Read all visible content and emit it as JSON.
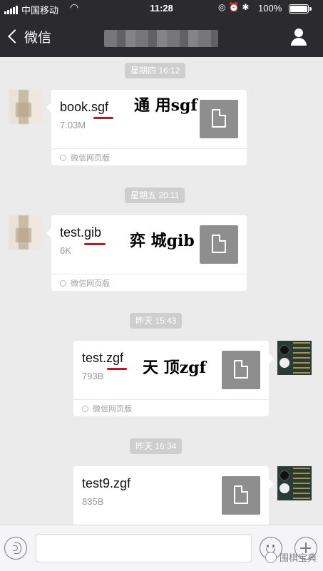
{
  "status_bar": {
    "carrier": "中国移动",
    "time": "11:28",
    "battery": "100%"
  },
  "nav": {
    "back_label": "微信"
  },
  "messages": [
    {
      "time": "星期四 16:12",
      "file_name": "book.sgf",
      "file_size": "7.03M",
      "source": "微信网页版",
      "annotation": "通 用sgf"
    },
    {
      "time": "星期五 20:11",
      "file_name": "test.gib",
      "file_size": "6K",
      "source": "微信网页版",
      "annotation": "弈 城gib"
    },
    {
      "time": "昨天 15:43",
      "file_name": "test.zgf",
      "file_size": "793B",
      "source": "微信网页版",
      "annotation": "天 顶zgf"
    },
    {
      "time": "昨天 16:34",
      "file_name": "test9.zgf",
      "file_size": "835B"
    }
  ],
  "input": {
    "value": ""
  },
  "watermark": "围棋宝典",
  "colors": {
    "nav_bg": "#2b2b2f",
    "chat_bg": "#ebebeb",
    "underline": "#c0171e"
  }
}
